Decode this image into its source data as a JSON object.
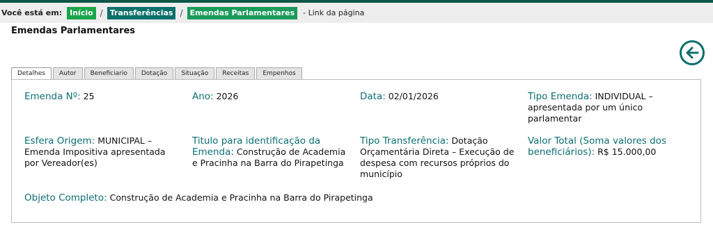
{
  "breadcrumb": {
    "label": "Você está em:",
    "items": [
      "Início",
      "Transferências",
      "Emendas Parlamentares"
    ],
    "separator": "/",
    "link_text": "- Link da página"
  },
  "page": {
    "title": "Emendas Parlamentares",
    "back_icon": "arrow-left-circle-icon"
  },
  "tabs": [
    "Detalhes",
    "Autor",
    "Beneficiario",
    "Dotação",
    "Situação",
    "Receitas",
    "Empenhos"
  ],
  "active_tab": "Detalhes",
  "details": {
    "emenda": {
      "label": "Emenda Nº:",
      "value": "25"
    },
    "ano": {
      "label": "Ano:",
      "value": "2026"
    },
    "data": {
      "label": "Data:",
      "value": "02/01/2026"
    },
    "tipo_emenda": {
      "label": "Tipo Emenda:",
      "value": "INDIVIDUAL – apresentada por um único parlamentar"
    },
    "esfera_origem": {
      "label": "Esfera Origem:",
      "value": "MUNICIPAL – Emenda Impositiva apresentada por Vereador(es)"
    },
    "titulo": {
      "label": "Titulo para identificação da Emenda:",
      "value": "Construção de Academia e Pracinha na Barra do Pirapetinga"
    },
    "tipo_transferencia": {
      "label": "Tipo Transferência:",
      "value": "Dotação Orçamentária Direta – Execução de despesa com recursos próprios do município"
    },
    "valor_total": {
      "label": "Valor Total (Soma valores dos beneficiários):",
      "value": "R$ 15.000,00"
    },
    "objeto": {
      "label": "Objeto Completo:",
      "value": "Construção de Academia e Pracinha na Barra do Pirapetinga"
    }
  },
  "colors": {
    "top_bar": "#0e5747",
    "breadcrumb_green": "#1aa54a",
    "breadcrumb_teal": "#0b6f6a",
    "label_color": "#0c6e73"
  }
}
